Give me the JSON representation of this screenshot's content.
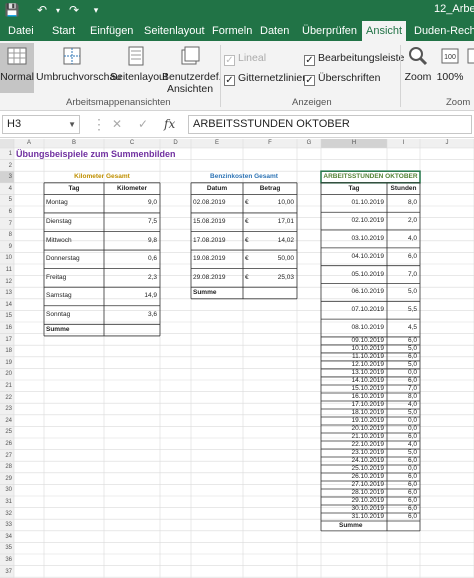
{
  "window": {
    "title": "12_Arbeit"
  },
  "tabs": [
    {
      "label": "Datei",
      "active": false
    },
    {
      "label": "Start",
      "active": false
    },
    {
      "label": "Einfügen",
      "active": false
    },
    {
      "label": "Seitenlayout",
      "active": false
    },
    {
      "label": "Formeln",
      "active": false
    },
    {
      "label": "Daten",
      "active": false
    },
    {
      "label": "Überprüfen",
      "active": false
    },
    {
      "label": "Ansicht",
      "active": true
    },
    {
      "label": "Duden-Rechtsc",
      "active": false
    }
  ],
  "ribbon": {
    "views": {
      "normal": "Normal",
      "page_break": "Umbruchvorschau",
      "page_layout": "Seitenlayout",
      "custom_line1": "Benutzerdef.",
      "custom_line2": "Ansichten",
      "group_label": "Arbeitsmappenansichten"
    },
    "show": {
      "lineal": "Lineal",
      "bearbeitungsleiste": "Bearbeitungsleiste",
      "gitternetzlinien": "Gitternetzlinien",
      "ueberschriften": "Überschriften",
      "group_label": "Anzeigen"
    },
    "zoom": {
      "zoom": "Zoom",
      "hundred": "100%",
      "group_label": "Zoom"
    }
  },
  "formula_bar": {
    "name_box": "H3",
    "fx": "fx",
    "content": "ARBEITSSTUNDEN OKTOBER"
  },
  "grid": {
    "columns": [
      "A",
      "B",
      "C",
      "D",
      "E",
      "F",
      "G",
      "H",
      "I",
      "J"
    ],
    "rows": [
      "1",
      "2",
      "3",
      "4",
      "5",
      "6",
      "7",
      "8",
      "9",
      "10",
      "11",
      "12",
      "13",
      "14",
      "15",
      "16",
      "17",
      "18",
      "19",
      "20",
      "21",
      "22",
      "23",
      "24",
      "25",
      "26",
      "27",
      "28",
      "29",
      "30",
      "31",
      "32",
      "33",
      "34",
      "35",
      "36",
      "37"
    ]
  },
  "sheet": {
    "title": "Übungsbeispiele zum Summenbilden",
    "km": {
      "header": "Kilometer Gesamt",
      "col_day": "Tag",
      "col_km": "Kilometer",
      "rows": [
        {
          "day": "Montag",
          "km": "9,0"
        },
        {
          "day": "Dienstag",
          "km": "7,5"
        },
        {
          "day": "Mittwoch",
          "km": "9,8"
        },
        {
          "day": "Donnerstag",
          "km": "0,6"
        },
        {
          "day": "Freitag",
          "km": "2,3"
        },
        {
          "day": "Samstag",
          "km": "14,9"
        },
        {
          "day": "Sonntag",
          "km": "3,6"
        }
      ],
      "sum_label": "Summe"
    },
    "fuel": {
      "header": "Benzinkosten Gesamt",
      "col_date": "Datum",
      "col_amount": "Betrag",
      "currency": "€",
      "rows": [
        {
          "date": "02.08.2019",
          "amount": "10,00"
        },
        {
          "date": "15.08.2019",
          "amount": "17,01"
        },
        {
          "date": "17.08.2019",
          "amount": "14,02"
        },
        {
          "date": "19.08.2019",
          "amount": "50,00"
        },
        {
          "date": "29.08.2019",
          "amount": "25,03"
        }
      ],
      "sum_label": "Summe"
    },
    "hours": {
      "header": "ARBEITSSTUNDEN OKTOBER",
      "col_day": "Tag",
      "col_hours": "Stunden",
      "rows": [
        {
          "date": "01.10.2019",
          "hours": "8,0"
        },
        {
          "date": "02.10.2019",
          "hours": "2,0"
        },
        {
          "date": "03.10.2019",
          "hours": "4,0"
        },
        {
          "date": "04.10.2019",
          "hours": "6,0"
        },
        {
          "date": "05.10.2019",
          "hours": "7,0"
        },
        {
          "date": "06.10.2019",
          "hours": "5,0"
        },
        {
          "date": "07.10.2019",
          "hours": "5,5"
        },
        {
          "date": "08.10.2019",
          "hours": "4,5"
        },
        {
          "date": "09.10.2019",
          "hours": "6,0"
        },
        {
          "date": "10.10.2019",
          "hours": "5,0"
        },
        {
          "date": "11.10.2019",
          "hours": "6,0"
        },
        {
          "date": "12.10.2019",
          "hours": "5,0"
        },
        {
          "date": "13.10.2019",
          "hours": "0,0"
        },
        {
          "date": "14.10.2019",
          "hours": "6,0"
        },
        {
          "date": "15.10.2019",
          "hours": "7,0"
        },
        {
          "date": "16.10.2019",
          "hours": "8,0"
        },
        {
          "date": "17.10.2019",
          "hours": "4,0"
        },
        {
          "date": "18.10.2019",
          "hours": "5,0"
        },
        {
          "date": "19.10.2019",
          "hours": "0,0"
        },
        {
          "date": "20.10.2019",
          "hours": "0,0"
        },
        {
          "date": "21.10.2019",
          "hours": "6,0"
        },
        {
          "date": "22.10.2019",
          "hours": "4,0"
        },
        {
          "date": "23.10.2019",
          "hours": "5,0"
        },
        {
          "date": "24.10.2019",
          "hours": "6,0"
        },
        {
          "date": "25.10.2019",
          "hours": "0,0"
        },
        {
          "date": "26.10.2019",
          "hours": "6,0"
        },
        {
          "date": "27.10.2019",
          "hours": "6,0"
        },
        {
          "date": "28.10.2019",
          "hours": "6,0"
        },
        {
          "date": "29.10.2019",
          "hours": "6,0"
        },
        {
          "date": "30.10.2019",
          "hours": "6,0"
        },
        {
          "date": "31.10.2019",
          "hours": "6,0"
        }
      ],
      "sum_label": "Summe"
    }
  },
  "colors": {
    "excel_green": "#217346",
    "title_purple": "#7030a0",
    "km_header": "#bf8f00",
    "fuel_header": "#2e74b5",
    "hours_header": "#548235"
  }
}
